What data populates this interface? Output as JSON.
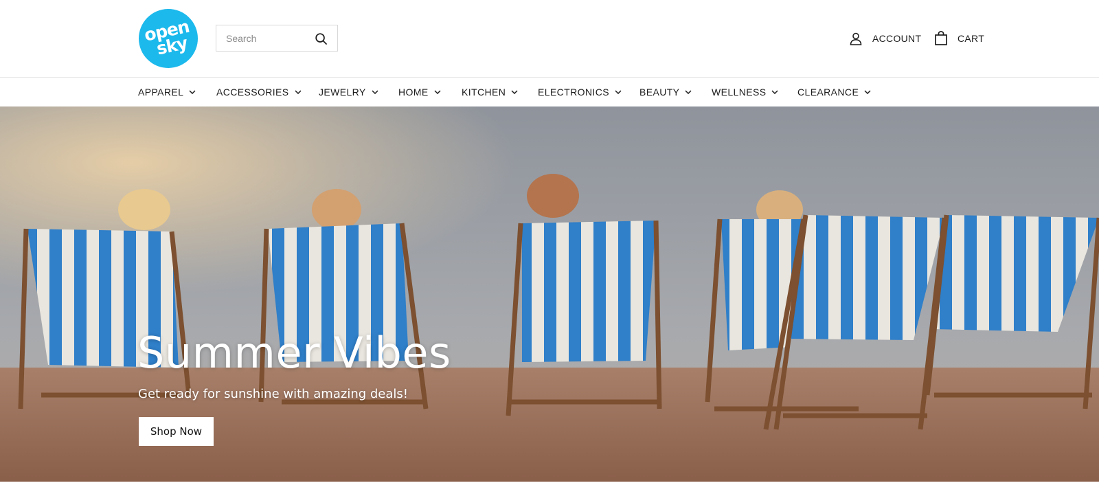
{
  "brand": {
    "logo_line1": "open",
    "logo_line2": "sky",
    "accent_color": "#1cb9ec"
  },
  "header": {
    "search_placeholder": "Search",
    "account_label": "ACCOUNT",
    "cart_label": "CART"
  },
  "nav": {
    "items": [
      {
        "label": "APPAREL"
      },
      {
        "label": "ACCESSORIES"
      },
      {
        "label": "JEWELRY"
      },
      {
        "label": "HOME"
      },
      {
        "label": "KITCHEN"
      },
      {
        "label": "ELECTRONICS"
      },
      {
        "label": "BEAUTY"
      },
      {
        "label": "WELLNESS"
      },
      {
        "label": "CLEARANCE"
      }
    ]
  },
  "hero": {
    "title": "Summer Vibes",
    "subtitle": "Get ready for sunshine with amazing deals!",
    "cta_label": "Shop Now"
  }
}
